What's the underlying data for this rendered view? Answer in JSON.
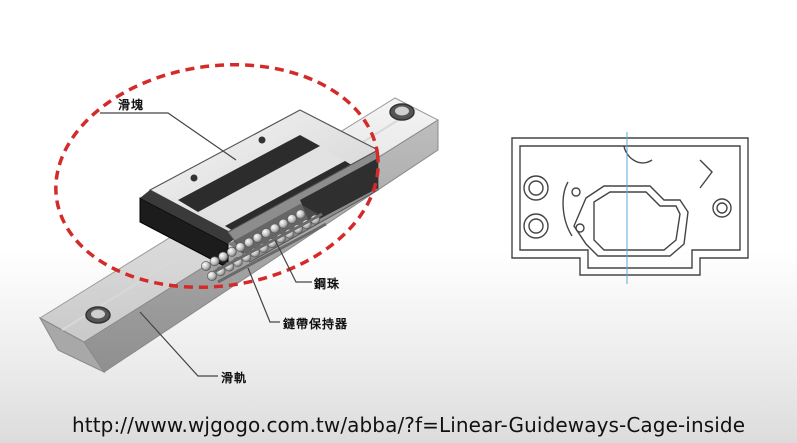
{
  "labels": {
    "slider": "滑塊",
    "steel_ball": "鋼珠",
    "chain_retainer": "鏈帶保持器",
    "rail": "滑軌"
  },
  "source_url": "http://www.wjgogo.com.tw/abba/?f=Linear-Guideways-Cage-inside",
  "colors": {
    "highlight_ellipse": "#d42a2a",
    "outline": "#444444",
    "center_line": "#5aa9d6"
  }
}
